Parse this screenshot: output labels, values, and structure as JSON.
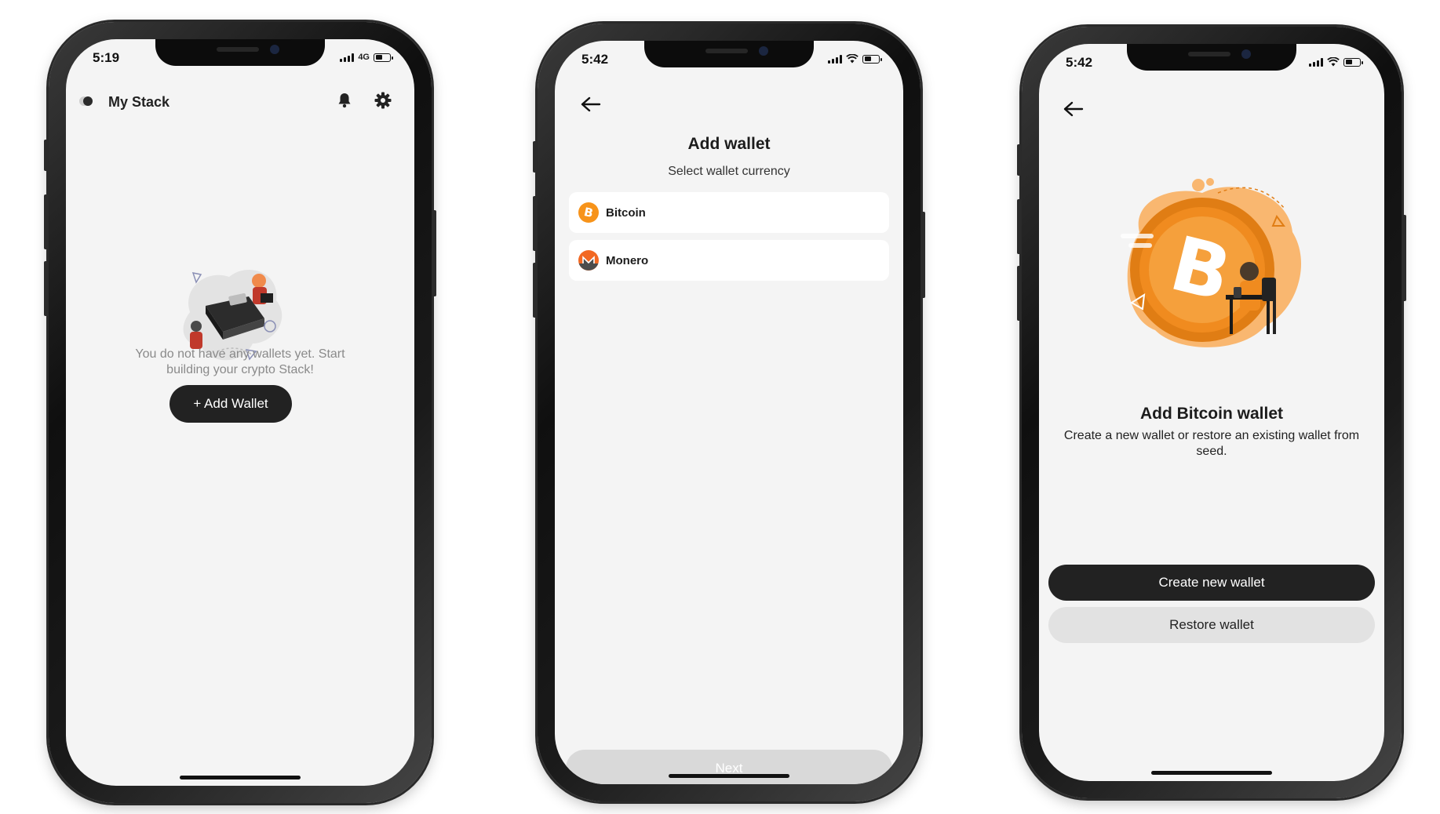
{
  "colors": {
    "screen_bg": "#f4f4f4",
    "primary_button": "#222222",
    "disabled_button": "#d9d9d9",
    "secondary_button": "#e2e2e2",
    "bitcoin_orange": "#f7931a",
    "monero_orange": "#f26822"
  },
  "screen1": {
    "status_time": "5:19",
    "network": "4G",
    "battery_level_pct": 45,
    "header_title": "My Stack",
    "empty_message": "You do not have any wallets yet. Start building your crypto Stack!",
    "add_wallet_label": "+ Add Wallet",
    "icons": [
      "theme-toggle-icon",
      "bell-icon",
      "gear-icon"
    ]
  },
  "screen2": {
    "status_time": "5:42",
    "battery_level_pct": 45,
    "title": "Add wallet",
    "subtitle": "Select wallet currency",
    "currencies": [
      {
        "label": "Bitcoin",
        "icon": "bitcoin-icon"
      },
      {
        "label": "Monero",
        "icon": "monero-icon"
      }
    ],
    "next_label": "Next"
  },
  "screen3": {
    "status_time": "5:42",
    "battery_level_pct": 45,
    "title": "Add Bitcoin wallet",
    "description": "Create a new wallet or restore an existing wallet from seed.",
    "create_label": "Create new wallet",
    "restore_label": "Restore wallet"
  }
}
